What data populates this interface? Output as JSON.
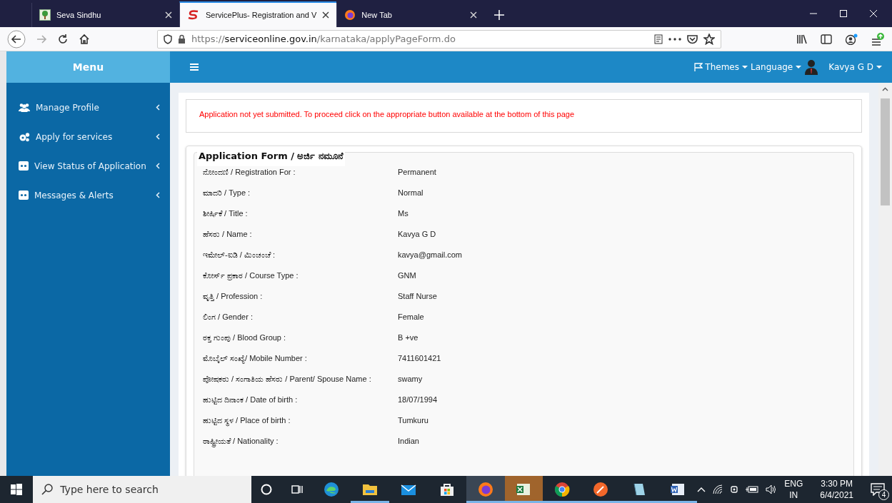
{
  "browser": {
    "tabs": [
      {
        "title": "Seva Sindhu",
        "selected": false
      },
      {
        "title": "ServicePlus- Registration and V",
        "selected": true
      },
      {
        "title": "New Tab",
        "selected": false
      }
    ],
    "url": {
      "scheme": "https://",
      "domain": "serviceonline.gov.in",
      "path": "/karnataka/applyPageForm.do"
    }
  },
  "sidebar": {
    "title": "Menu",
    "items": [
      {
        "label": "Manage Profile"
      },
      {
        "label": "Apply for services"
      },
      {
        "label": "View Status of Application"
      },
      {
        "label": "Messages & Alerts"
      }
    ]
  },
  "header": {
    "themes": "Themes",
    "language": "Language",
    "user": "Kavya G D"
  },
  "notice": "Application not yet submitted. To proceed click on the appropriate button available at the bottom of this page",
  "form": {
    "title": "Application Form / ಅರ್ಜಿ ನಮೂನೆ",
    "fields": [
      {
        "label": "ನೋಂದಣಿ / Registration For :",
        "value": "Permanent"
      },
      {
        "label": "ಮಾದರಿ / Type :",
        "value": "Normal"
      },
      {
        "label": "ಶೀರ್ಷಿಕೆ / Title :",
        "value": "Ms"
      },
      {
        "label": "ಹೆಸರು / Name :",
        "value": "Kavya G D"
      },
      {
        "label": "ಇಮೇಲ್-ಐಡಿ / ಮಿಂಚಂಚೆ :",
        "value": "kavya@gmail.com"
      },
      {
        "label": "ಕೋರ್ಸ್ ಪ್ರಕಾರ / Course Type :",
        "value": "GNM"
      },
      {
        "label": "ವೃತ್ತಿ / Profession :",
        "value": "Staff Nurse"
      },
      {
        "label": "ಲಿಂಗ / Gender :",
        "value": "Female"
      },
      {
        "label": "ರಕ್ತ ಗುಂಪು / Blood Group :",
        "value": "B +ve"
      },
      {
        "label": "ಮೊಬೈಲ್ ಸಂಖ್ಯೆ/ Mobile Number :",
        "value": "7411601421"
      },
      {
        "label": "ಪೋಷಕರು / ಸಂಗಾತಿಯ ಹೆಸರು / Parent/ Spouse Name :",
        "value": "swamy"
      },
      {
        "label": "ಹುಟ್ಟಿದ ದಿನಾಂಕ / Date of birth :",
        "value": "18/07/1994"
      },
      {
        "label": "ಹುಟ್ಟಿದ ಸ್ಥಳ / Place of birth :",
        "value": "Tumkuru"
      },
      {
        "label": "ರಾಷ್ಟ್ರೀಯತೆ / Nationality :",
        "value": "Indian"
      }
    ]
  },
  "taskbar": {
    "search_placeholder": "Type here to search",
    "apps": [
      {
        "kind": "edge",
        "running": false
      },
      {
        "kind": "folder",
        "running": true
      },
      {
        "kind": "mail",
        "running": false
      },
      {
        "kind": "store",
        "running": false
      },
      {
        "kind": "firefox",
        "running": true
      },
      {
        "kind": "excel",
        "running": true
      },
      {
        "kind": "chrome",
        "running": true
      },
      {
        "kind": "pen",
        "running": true
      },
      {
        "kind": "notepad",
        "running": true
      },
      {
        "kind": "word",
        "running": true
      }
    ],
    "language": "ENG",
    "region": "IN",
    "time": "3:30 PM",
    "date": "6/4/2021",
    "notifications": "4"
  }
}
